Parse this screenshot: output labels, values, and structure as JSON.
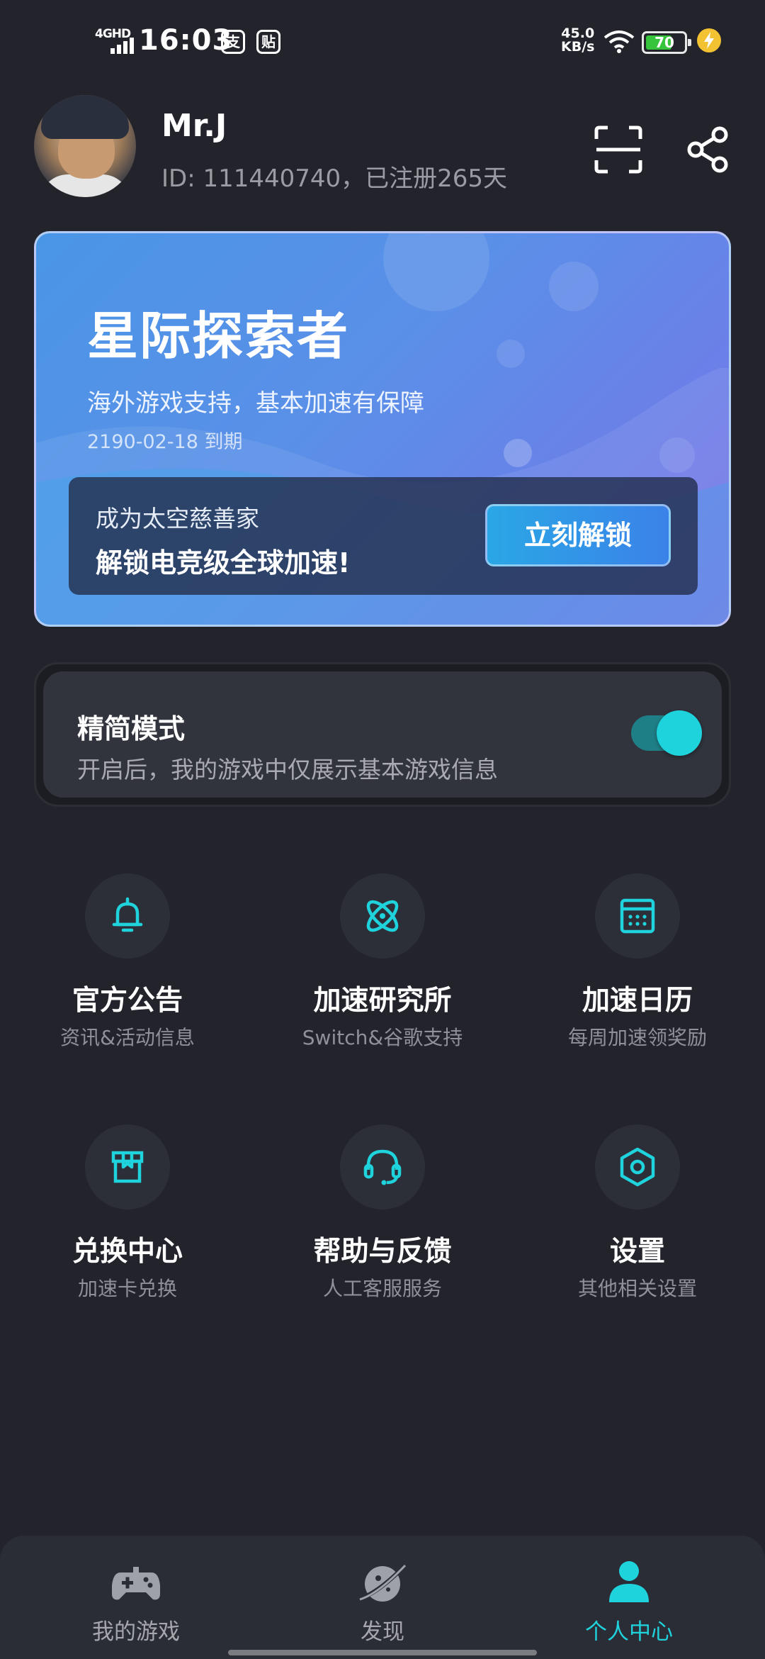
{
  "status_bar": {
    "network": "4GHD",
    "time": "16:03",
    "app1": "支",
    "app2": "贴",
    "speed_value": "45.0",
    "speed_unit": "KB/s",
    "battery": "70",
    "battery_level": 0.7
  },
  "profile": {
    "name": "Mr.J",
    "id_line": "ID: 111440740，已注册265天"
  },
  "vip_card": {
    "title": "星际探索者",
    "description": "海外游戏支持，基本加速有保障",
    "expiry": "2190-02-18  到期",
    "promo_line1": "成为太空慈善家",
    "promo_line2": "解锁电竞级全球加速!",
    "unlock_button": "立刻解锁"
  },
  "simple_mode": {
    "title": "精简模式",
    "description": "开启后，我的游戏中仅展示基本游戏信息",
    "enabled": true
  },
  "menu": [
    {
      "label": "官方公告",
      "sub": "资讯&活动信息",
      "icon": "bell-icon"
    },
    {
      "label": "加速研究所",
      "sub": "Switch&谷歌支持",
      "icon": "atom-icon"
    },
    {
      "label": "加速日历",
      "sub": "每周加速领奖励",
      "icon": "calendar-icon"
    },
    {
      "label": "兑换中心",
      "sub": "加速卡兑换",
      "icon": "gift-box-icon"
    },
    {
      "label": "帮助与反馈",
      "sub": "人工客服服务",
      "icon": "headset-icon"
    },
    {
      "label": "设置",
      "sub": "其他相关设置",
      "icon": "settings-hexagon-icon"
    }
  ],
  "bottom_nav": [
    {
      "label": "我的游戏",
      "icon": "gamepad-icon",
      "active": false
    },
    {
      "label": "发现",
      "icon": "planet-icon",
      "active": false
    },
    {
      "label": "个人中心",
      "icon": "person-icon",
      "active": true
    }
  ],
  "colors": {
    "background": "#22232b",
    "accent": "#1fd3dd",
    "card_gradient_start": "#4a96e6",
    "card_gradient_end": "#7a74e4"
  }
}
